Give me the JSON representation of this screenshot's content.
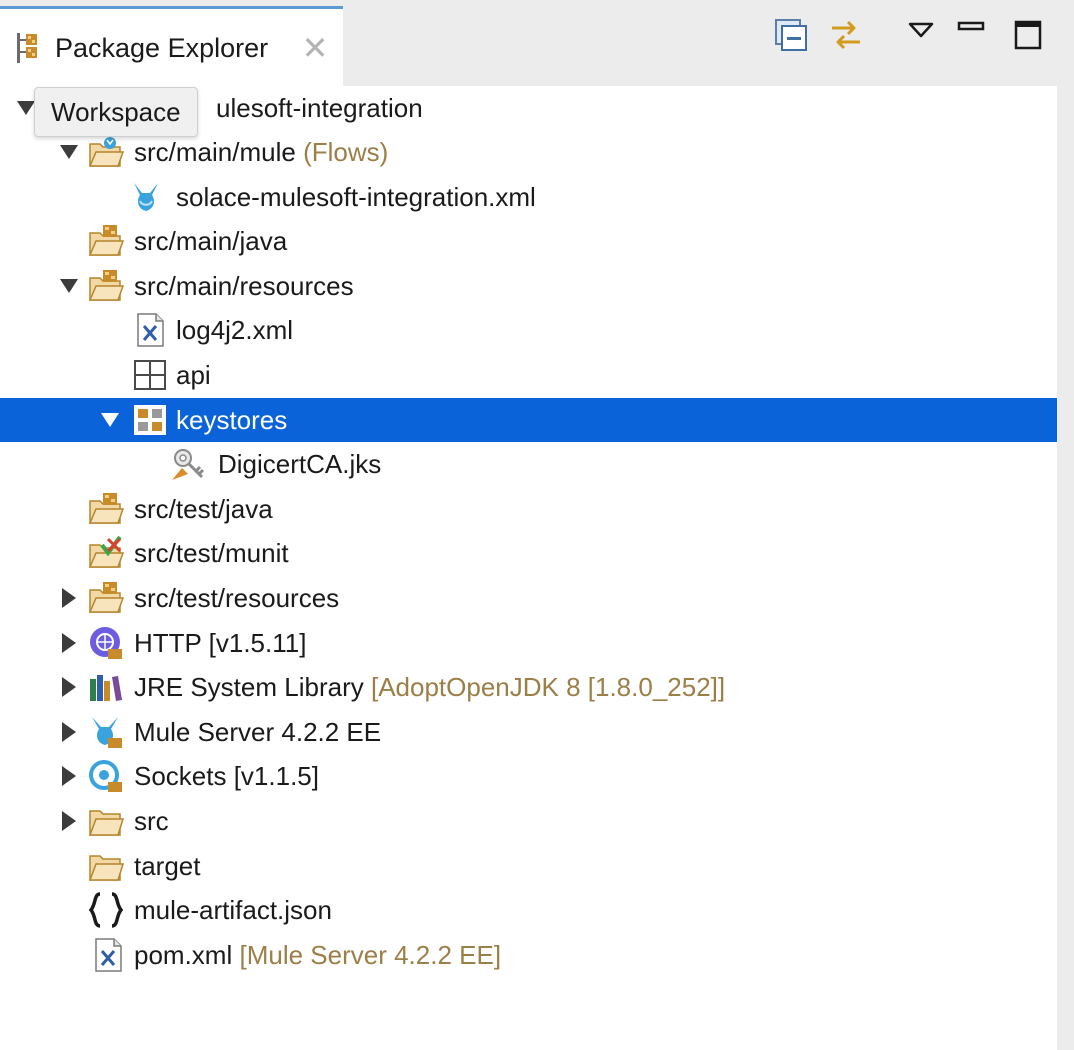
{
  "view": {
    "tab_title": "Package Explorer",
    "close_glyph": "✕",
    "toolbar": [
      "collapse-all-icon",
      "link-with-editor-icon",
      "view-menu-icon",
      "minimize-icon",
      "maximize-icon"
    ]
  },
  "tooltip": {
    "text": "Workspace"
  },
  "tree": {
    "project_label": "ulesoft-integration",
    "flows_path": "src/main/mule",
    "flows_decoration": "(Flows)",
    "flow_file": "solace-mulesoft-integration.xml",
    "main_java": "src/main/java",
    "main_resources": "src/main/resources",
    "log_file": "log4j2.xml",
    "api_folder": "api",
    "keystores_folder": "keystores",
    "keystore_file": "DigicertCA.jks",
    "test_java": "src/test/java",
    "test_munit": "src/test/munit",
    "test_resources": "src/test/resources",
    "http_lib": "HTTP [v1.5.11]",
    "jre_lib": "JRE System Library",
    "jre_decoration": "[AdoptOpenJDK 8 [1.8.0_252]]",
    "mule_server": "Mule Server 4.2.2 EE",
    "sockets_lib": "Sockets [v1.1.5]",
    "src_folder": "src",
    "target_folder": "target",
    "artifact_file": "mule-artifact.json",
    "pom_file": "pom.xml",
    "pom_decoration": "[Mule Server 4.2.2 EE]"
  },
  "colors": {
    "selection": "#0a63d8",
    "decoration": "#9b7f47",
    "tab_accent": "#5b9bd5"
  }
}
